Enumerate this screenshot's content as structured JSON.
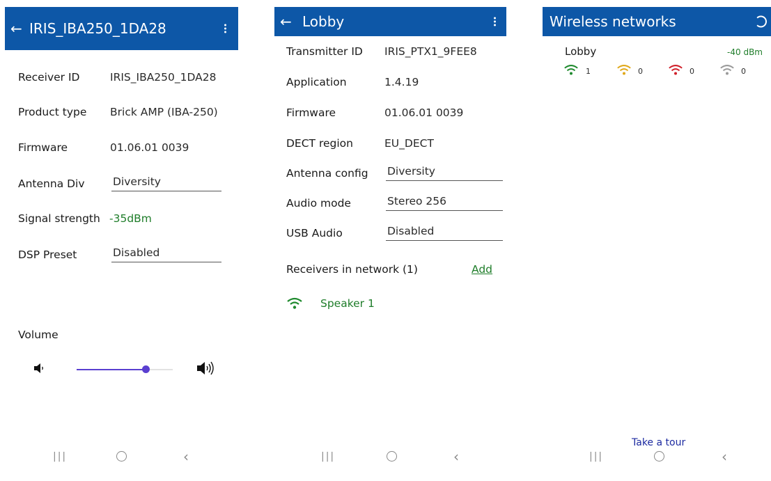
{
  "screen1": {
    "title": "IRIS_IBA250_1DA28",
    "rows": [
      {
        "label": "Receiver ID",
        "value": "IRIS_IBA250_1DA28"
      },
      {
        "label": "Product type",
        "value": "Brick AMP (IBA-250)"
      },
      {
        "label": "Firmware",
        "value": "01.06.01 0039"
      },
      {
        "label": "Antenna Div",
        "value": "Diversity"
      },
      {
        "label": "Signal strength",
        "value": "-35dBm"
      },
      {
        "label": "DSP Preset",
        "value": "Disabled"
      }
    ],
    "volume_label": "Volume",
    "volume_level": 0.72
  },
  "screen2": {
    "title": "Lobby",
    "rows": [
      {
        "label": "Transmitter ID",
        "value": "IRIS_PTX1_9FEE8"
      },
      {
        "label": "Application",
        "value": "1.4.19"
      },
      {
        "label": "Firmware",
        "value": "01.06.01 0039"
      },
      {
        "label": "DECT region",
        "value": "EU_DECT"
      },
      {
        "label": "Antenna config",
        "value": "Diversity"
      },
      {
        "label": "Audio mode",
        "value": "Stereo 256"
      },
      {
        "label": "USB Audio",
        "value": "Disabled"
      }
    ],
    "receivers_label": "Receivers in network (1)",
    "add_label": "Add",
    "speaker_name": "Speaker 1"
  },
  "screen3": {
    "title": "Wireless networks",
    "network": {
      "name": "Lobby",
      "signal": "-40 dBm",
      "counts": [
        {
          "color": "#1f8a2e",
          "value": "1"
        },
        {
          "color": "#e0a81a",
          "value": "0"
        },
        {
          "color": "#d0202a",
          "value": "0"
        },
        {
          "color": "#9a9a9a",
          "value": "0"
        }
      ]
    },
    "tour_label": "Take a tour"
  },
  "colors": {
    "appbar": "#0d57a7",
    "accent_green": "#1f7d2a",
    "slider": "#5a3fd0",
    "link_blue": "#1c2aa0"
  },
  "icons": [
    "back-arrow-icon",
    "more-vert-icon",
    "refresh-icon",
    "speaker-low-icon",
    "speaker-high-icon",
    "wifi-icon",
    "nav-recents-icon",
    "nav-home-icon",
    "nav-back-icon"
  ]
}
